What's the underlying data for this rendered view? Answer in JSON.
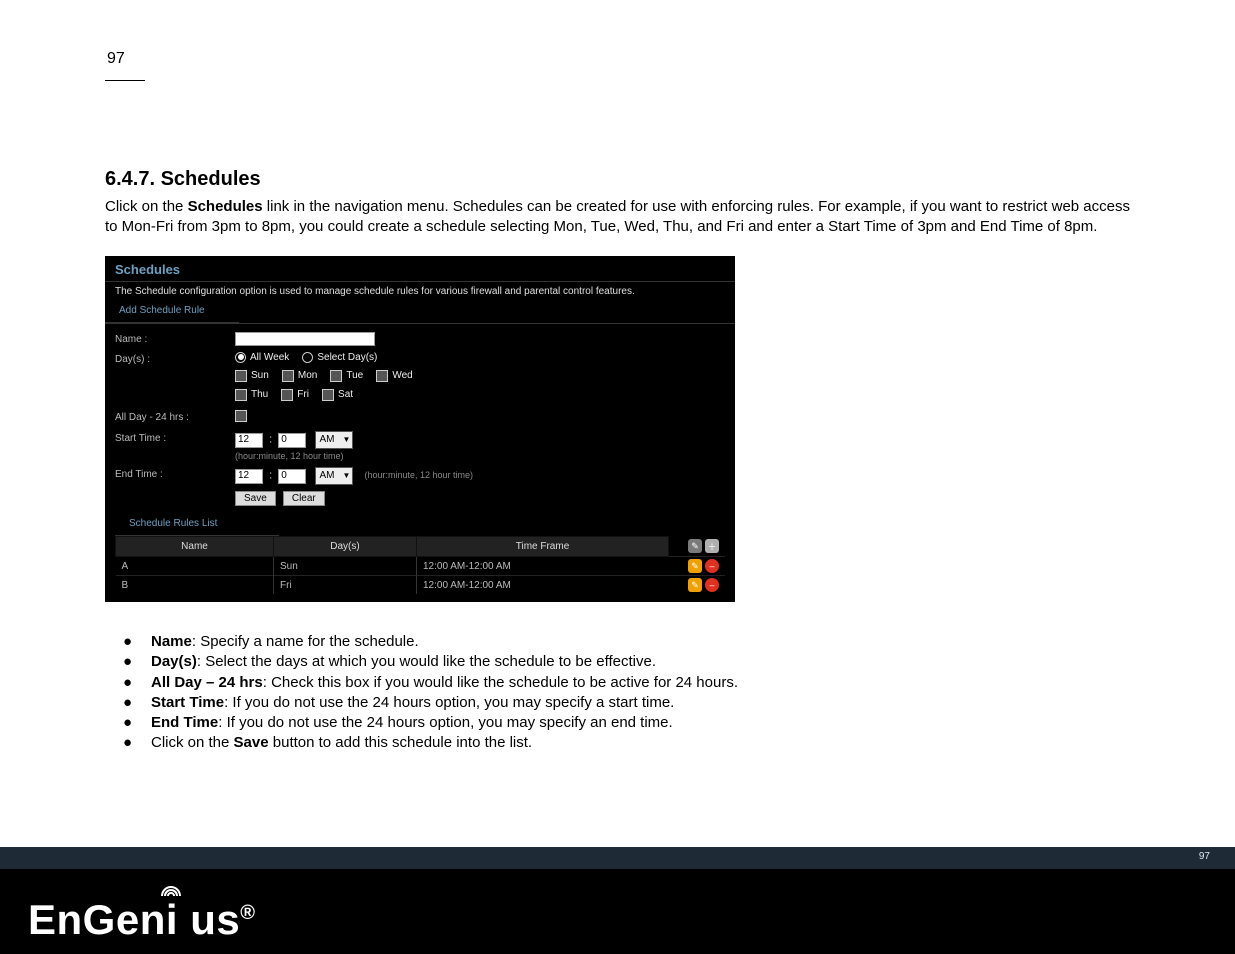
{
  "page_number_top": "97",
  "footer_page_number": "97",
  "section_number_title": "6.4.7. Schedules",
  "intro_paragraph": "Click on the Schedules link in the navigation menu. Schedules can be created for use with enforcing rules. For example, if you want to restrict web access to Mon-Fri from 3pm to 8pm, you could create a schedule selecting Mon, Tue, Wed, Thu, and Fri and enter a Start Time of 3pm and End Time of 8pm.",
  "panel": {
    "title": "Schedules",
    "description": "The Schedule configuration option is used to manage schedule rules for various firewall and parental control features.",
    "add_tab": "Add Schedule Rule",
    "labels": {
      "name": "Name :",
      "days": "Day(s) :",
      "all_day": "All Day - 24 hrs :",
      "start_time": "Start Time :",
      "end_time": "End Time :"
    },
    "radios": {
      "all_week": "All Week",
      "select_days": "Select Day(s)"
    },
    "days_cb": {
      "sun": "Sun",
      "mon": "Mon",
      "tue": "Tue",
      "wed": "Wed",
      "thu": "Thu",
      "fri": "Fri",
      "sat": "Sat"
    },
    "start": {
      "hour": "12",
      "minute": "0",
      "ampm": "AM",
      "hint": "(hour:minute, 12 hour time)"
    },
    "end": {
      "hour": "12",
      "minute": "0",
      "ampm": "AM",
      "hint": "(hour:minute, 12 hour time)"
    },
    "buttons": {
      "save": "Save",
      "clear": "Clear"
    },
    "rules_tab": "Schedule Rules List",
    "table": {
      "headers": {
        "name": "Name",
        "days": "Day(s)",
        "timeframe": "Time Frame"
      },
      "rows": [
        {
          "name": "A",
          "days": "Sun",
          "timeframe": "12:00 AM-12:00 AM"
        },
        {
          "name": "B",
          "days": "Fri",
          "timeframe": "12:00 AM-12:00 AM"
        }
      ]
    }
  },
  "field_descriptions": {
    "name": {
      "label": "Name",
      "text": ": Specify a name for the schedule."
    },
    "days": {
      "label": "Day(s)",
      "text": ": Select the days at which you would like the schedule to be effective."
    },
    "all_day": {
      "label": "All Day – 24 hrs",
      "text": ": Check this box if you would like the schedule to be active for 24 hours."
    },
    "start": {
      "label": "Start Time",
      "text": ": If you do not use the 24 hours option, you may specify a start time."
    },
    "end": {
      "label": "End Time",
      "text": ": If you do not use the 24 hours option, you may specify an end time."
    },
    "save": {
      "prefix": "Click on the ",
      "label": "Save",
      "text": " button to add this schedule into the list."
    }
  },
  "logo_text": "EnGenius",
  "logo_reg": "®"
}
